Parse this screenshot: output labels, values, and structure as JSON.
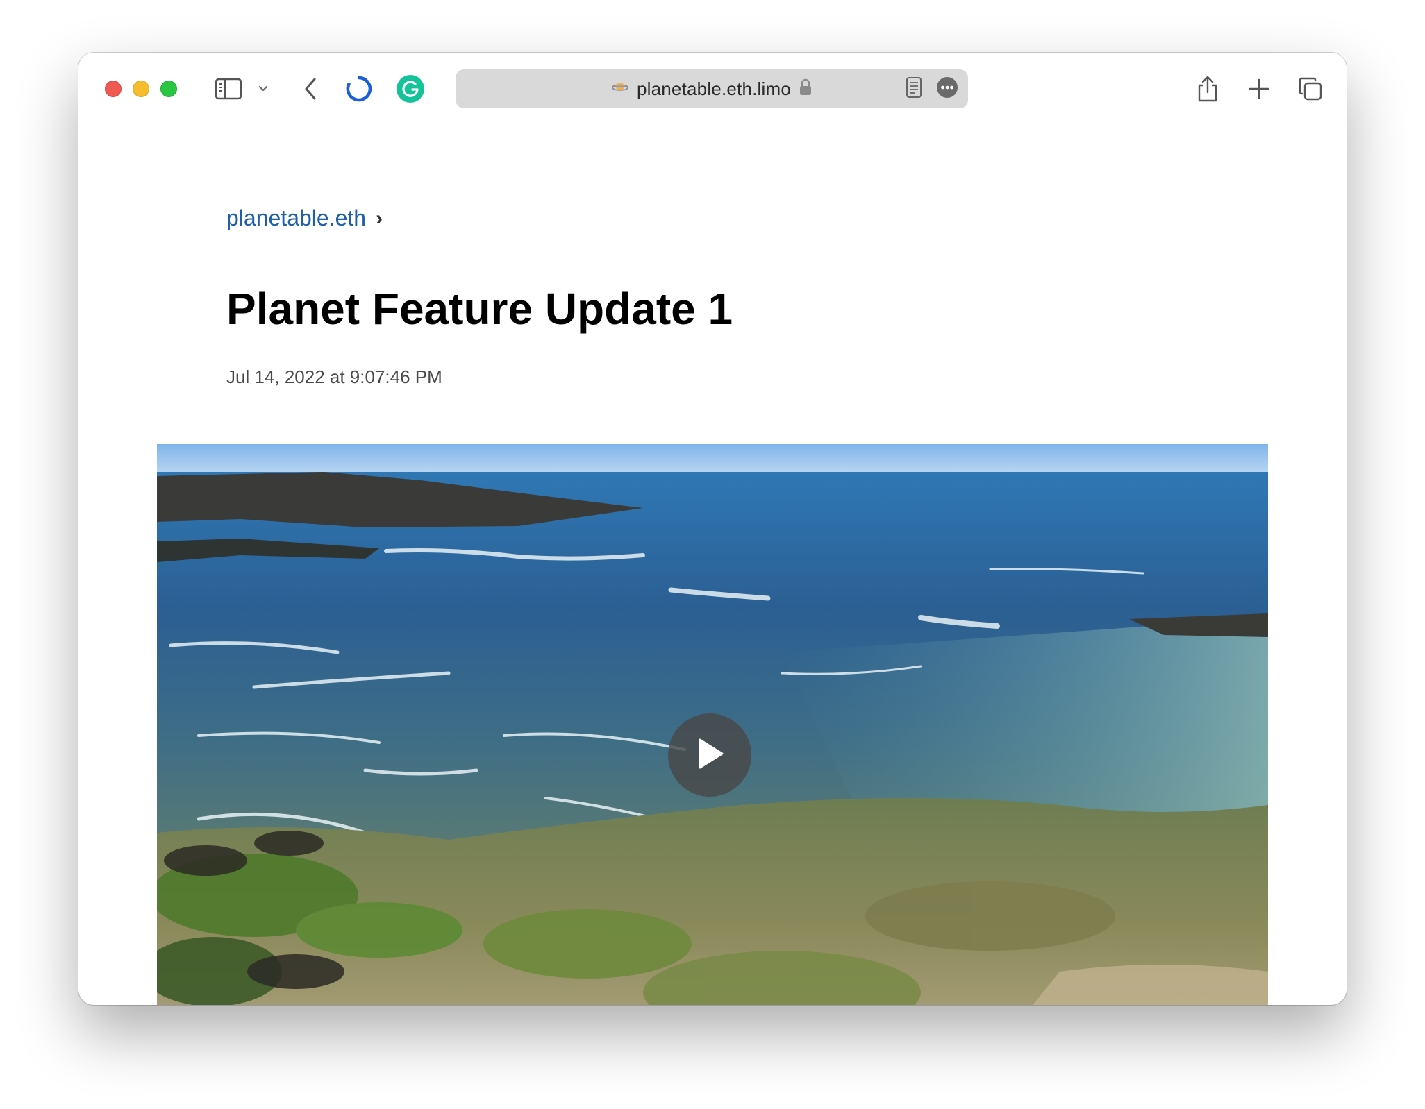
{
  "browser": {
    "address": "planetable.eth.limo",
    "site_icon": "planet-icon",
    "secure_icon": "lock-icon",
    "toolbar_icons": [
      "sidebar-icon",
      "chevron-down-icon",
      "back-icon",
      "loading-spinner-icon",
      "grammarly-icon",
      "reader-icon",
      "more-icon",
      "share-icon",
      "plus-icon",
      "tabs-icon"
    ],
    "colors": {
      "close": "#ee5a52",
      "minimize": "#f5bd2e",
      "maximize": "#2ac641",
      "spinner": "#1a5fd6",
      "grammarly": "#15c39a"
    }
  },
  "page": {
    "breadcrumb": {
      "site": "planetable.eth",
      "separator": "›"
    },
    "title": "Planet Feature Update 1",
    "date": "Jul 14, 2022 at 9:07:46 PM",
    "video": {
      "description_icon": "play-icon"
    },
    "colors": {
      "link": "#1f5faa"
    }
  }
}
